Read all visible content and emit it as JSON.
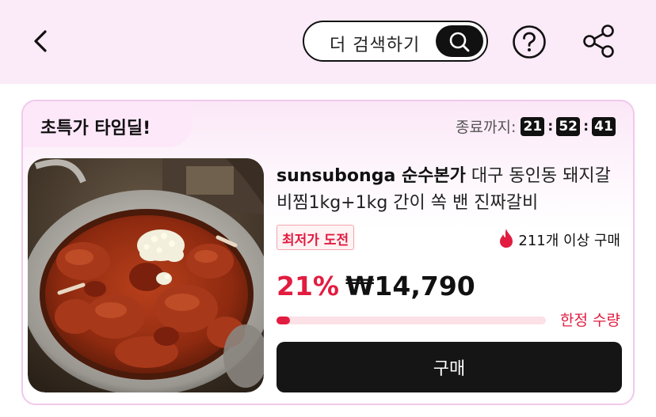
{
  "header": {
    "search_label": "더 검색하기",
    "icons": [
      "back-arrow-icon",
      "search-icon",
      "help-icon",
      "share-icon"
    ]
  },
  "deal": {
    "section_title": "초특가 타임딜!",
    "countdown_label": "종료까지:",
    "countdown": {
      "hours": "21",
      "minutes": "52",
      "seconds": "41"
    }
  },
  "product": {
    "brand": "sunsubonga 순수본가",
    "title_rest": " 대구 동인동 돼지갈비찜1kg+1kg 간이 쏙 밴 진짜갈비",
    "badge": "최저가 도전",
    "sold_count": "211개 이상 구매",
    "discount": "21%",
    "price": "₩14,790",
    "stock_fraction": 0.05,
    "limited_label": "한정 수량",
    "buy_label": "구매",
    "image_icon": "braised-pork-ribs-photo"
  },
  "colors": {
    "header_bg": "#fbeaf8",
    "accent_red": "#e21c40",
    "card_border": "#f1c9ec",
    "buy_button": "#151515"
  }
}
